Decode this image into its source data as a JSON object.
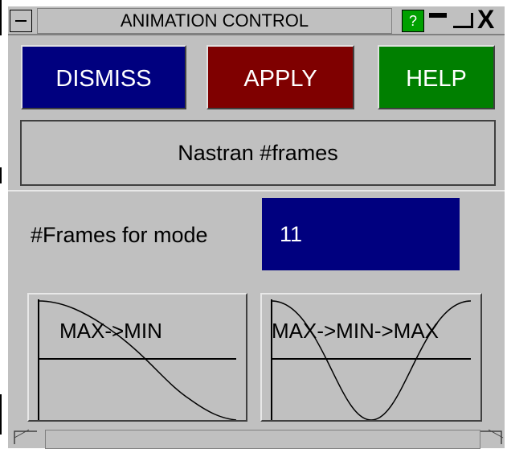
{
  "window": {
    "title": "ANIMATION CONTROL",
    "help_glyph": "?",
    "close_glyph": "X"
  },
  "buttons": {
    "dismiss": "DISMISS",
    "apply": "APPLY",
    "help": "HELP"
  },
  "section_title": "Nastran #frames",
  "frames": {
    "label": "#Frames for mode",
    "value": "11"
  },
  "curves": {
    "max_min": "MAX->MIN",
    "max_min_max": "MAX->MIN->MAX"
  },
  "colors": {
    "dismiss": "#00007f",
    "apply": "#7f0000",
    "help": "#007f00",
    "field": "#00007f",
    "panel": "#c0c0c0"
  }
}
